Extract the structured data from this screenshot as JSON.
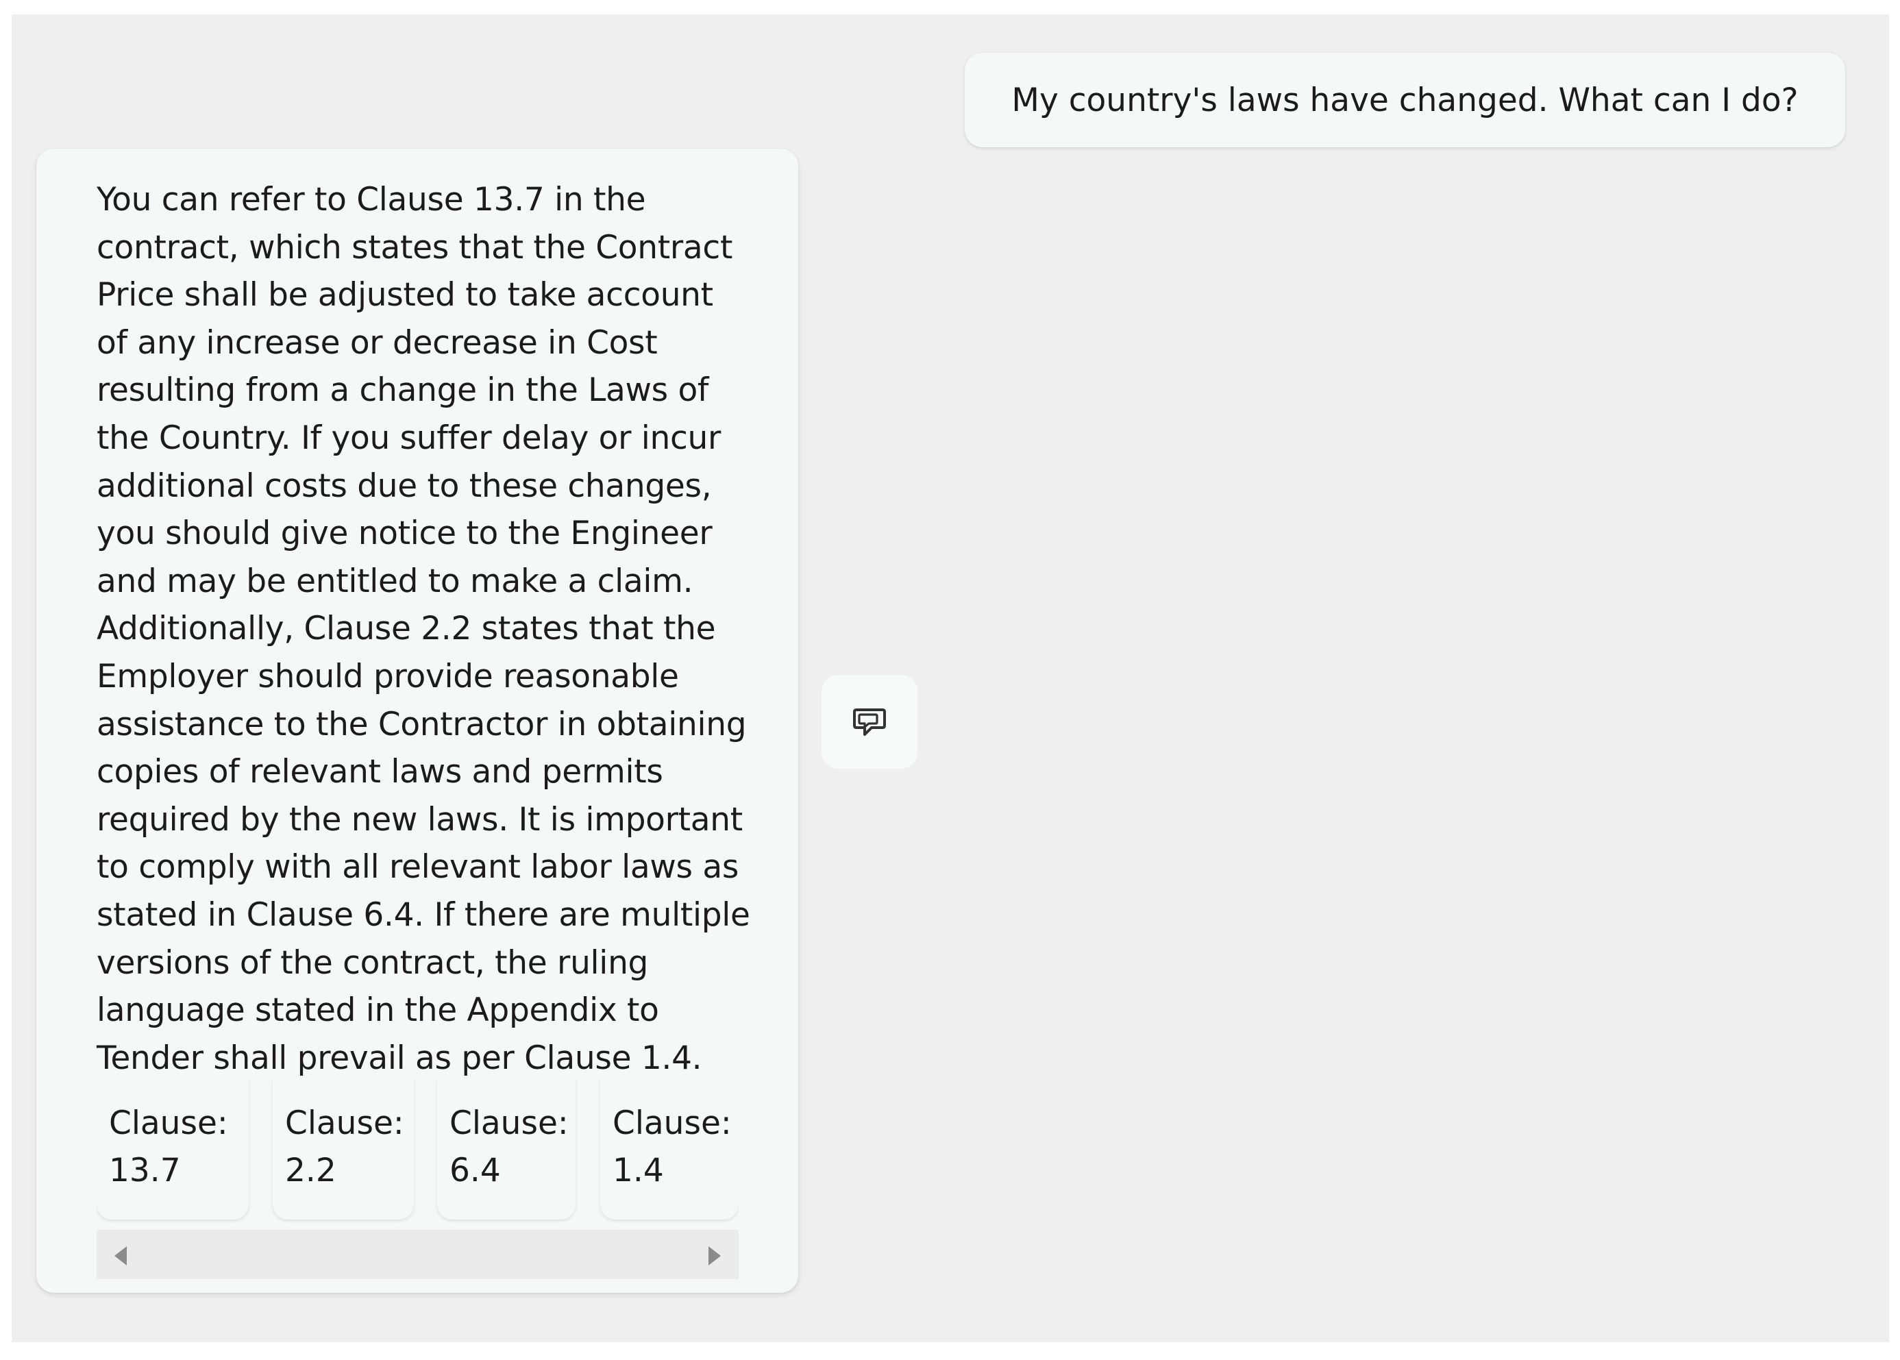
{
  "conversation": {
    "user_message": "My country's laws have changed. What can I do?",
    "bot_message_lines": [
      "You can refer to Clause 13.7 in the",
      "contract, which states that the Contract",
      "Price shall be adjusted to take account",
      "of any increase or decrease in Cost",
      "resulting from a change in the Laws of",
      "the Country. If you suffer delay or incur",
      "additional costs due to these changes,",
      "you should give notice to the Engineer",
      "and may be entitled to make a claim.",
      "Additionally, Clause 2.2 states that the",
      "Employer should provide reasonable",
      "assistance to the Contractor in obtaining",
      "copies of relevant laws and permits",
      "required by the new laws. It is important",
      "to comply with all relevant labor laws as",
      "stated in Clause 6.4. If there are multiple",
      "versions of the contract, the ruling",
      "language stated in the Appendix to",
      "Tender shall prevail as per Clause 1.4."
    ],
    "citations": [
      {
        "prefix": "Clause:",
        "number": "13.7"
      },
      {
        "prefix": "Clause:",
        "number": "2.2"
      },
      {
        "prefix": "Clause:",
        "number": "6.4"
      },
      {
        "prefix": "Clause:",
        "number": "1.4"
      }
    ]
  },
  "icons": {
    "feedback": "chat-feedback-icon",
    "scroll_left": "scroll-left-arrow-icon",
    "scroll_right": "scroll-right-arrow-icon"
  },
  "colors": {
    "background": "#efefef",
    "bubble": "#f4f8f9",
    "text": "#1b1b1b",
    "scrollbar_track": "#e9ebec",
    "scrollbar_arrow": "#8a8a8a"
  }
}
